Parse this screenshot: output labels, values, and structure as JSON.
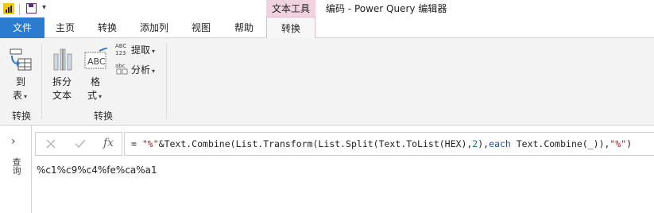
{
  "title_bar": {
    "context_group": "文本工具",
    "window_title": "编码 - Power Query 编辑器"
  },
  "tabs": {
    "file": "文件",
    "home": "主页",
    "transform": "转换",
    "add_column": "添加列",
    "view": "视图",
    "help": "帮助",
    "text_transform": "转换"
  },
  "ribbon": {
    "to_table_line1": "到",
    "to_table_line2": "表",
    "group1_label": "转换",
    "split_line1": "拆分",
    "split_line2": "文本",
    "format_line1": "格",
    "format_line2": "式",
    "extract": "提取",
    "parse": "分析",
    "group2_label": "转换",
    "extract_icon_text_top": "ABC",
    "extract_icon_text_bottom": "123",
    "parse_icon_text": "abc",
    "format_icon_text": "ABC"
  },
  "formula_bar": {
    "cancel_icon": "close-icon",
    "confirm_icon": "check-icon",
    "fx_label": "fx",
    "formula": {
      "eq": "= ",
      "s1": "\"%\"",
      "p1": "&Text.Combine(List.Transform(List.Split(Text.ToList(HEX),",
      "n1": "2",
      "p2": "),",
      "kw1": "each",
      "p3": " Text.Combine(_)),",
      "s2": "\"%\"",
      "p4": ")"
    }
  },
  "left_pane": {
    "expand": "›",
    "queries_label": "查询"
  },
  "result": "%c1%c9%c4%fe%ca%a1"
}
